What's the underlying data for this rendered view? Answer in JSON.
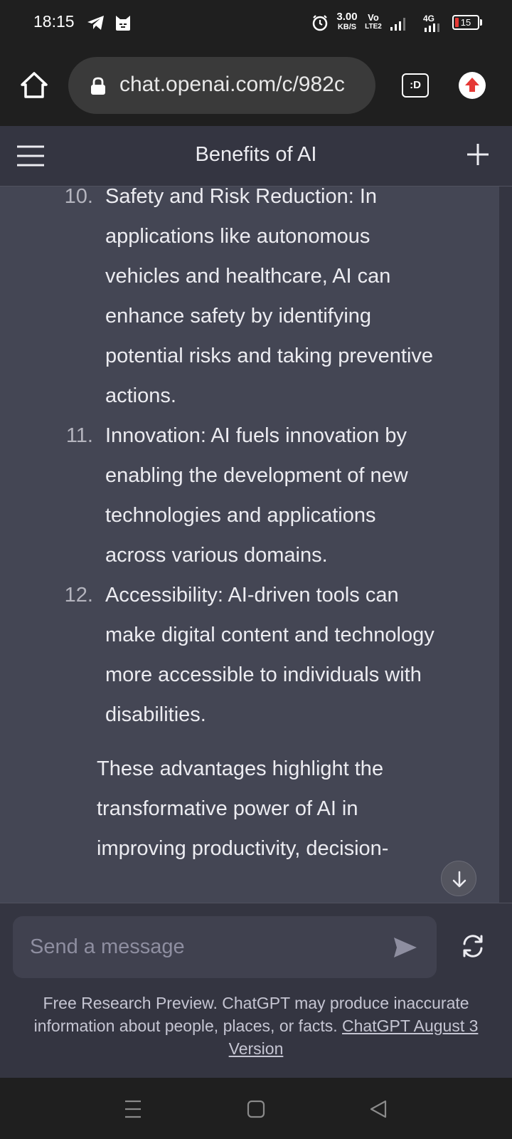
{
  "status_bar": {
    "time": "18:15",
    "net_speed_value": "3.00",
    "net_speed_unit": "KB/S",
    "volte_top": "Vo",
    "volte_bottom": "LTE2",
    "network_type": "4G",
    "battery_level": "15",
    "icons": [
      "telegram-icon",
      "cat-app-icon",
      "alarm-icon",
      "signal-icon",
      "battery-icon"
    ]
  },
  "browser": {
    "url": "chat.openai.com/c/982c",
    "extension_label": ":D",
    "icons": [
      "home-icon",
      "lock-icon",
      "update-arrow-icon"
    ]
  },
  "header": {
    "title": "Benefits of AI"
  },
  "chat": {
    "list_items": [
      {
        "number": "10.",
        "lines": [
          "Safety and Risk Reduction: In",
          "applications like autonomous",
          "vehicles and healthcare, AI can",
          "enhance safety by identifying",
          "potential risks and taking preventive",
          "actions."
        ]
      },
      {
        "number": "11.",
        "lines": [
          "Innovation: AI fuels innovation by",
          "enabling the development of new",
          "technologies and applications",
          "across various domains."
        ]
      },
      {
        "number": "12.",
        "lines": [
          "Accessibility: AI-driven tools can",
          "make digital content and technology",
          "more accessible to individuals with",
          "disabilities."
        ]
      }
    ],
    "summary_lines": [
      "These advantages highlight the",
      "transformative power of AI in",
      "improving productivity, decision-"
    ]
  },
  "composer": {
    "placeholder": "Send a message",
    "disclaimer_text": "Free Research Preview. ChatGPT may produce inaccurate information about people, places, or facts. ",
    "disclaimer_link": "ChatGPT August 3 Version"
  },
  "colors": {
    "chat_bg": "#444654",
    "header_bg": "#343541",
    "input_bg": "#40414f",
    "update_red": "#e53935"
  }
}
